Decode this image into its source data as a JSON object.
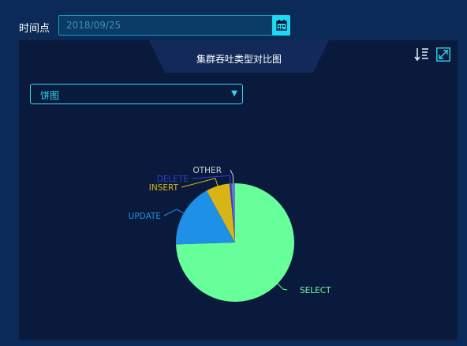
{
  "filter": {
    "label": "时间点",
    "date_value": "2018/09/25"
  },
  "panel": {
    "title": "集群吞吐类型对比图",
    "chart_type_selected": "饼图"
  },
  "colors": {
    "accent": "#20d7f4"
  },
  "icons": {
    "calendar": "calendar-icon",
    "sort": "sort-icon",
    "expand": "expand-icon"
  },
  "chart_data": {
    "type": "pie",
    "title": "集群吞吐类型对比图",
    "slices": [
      {
        "label": "SELECT",
        "value": 74.5,
        "color": "#67ff9a"
      },
      {
        "label": "UPDATE",
        "value": 17.5,
        "color": "#1f90e8"
      },
      {
        "label": "INSERT",
        "value": 6.5,
        "color": "#d8b514"
      },
      {
        "label": "DELETE",
        "value": 0.5,
        "color": "#2c3fd6"
      },
      {
        "label": "OTHER",
        "value": 1.0,
        "color": "#6a78cc"
      }
    ]
  }
}
